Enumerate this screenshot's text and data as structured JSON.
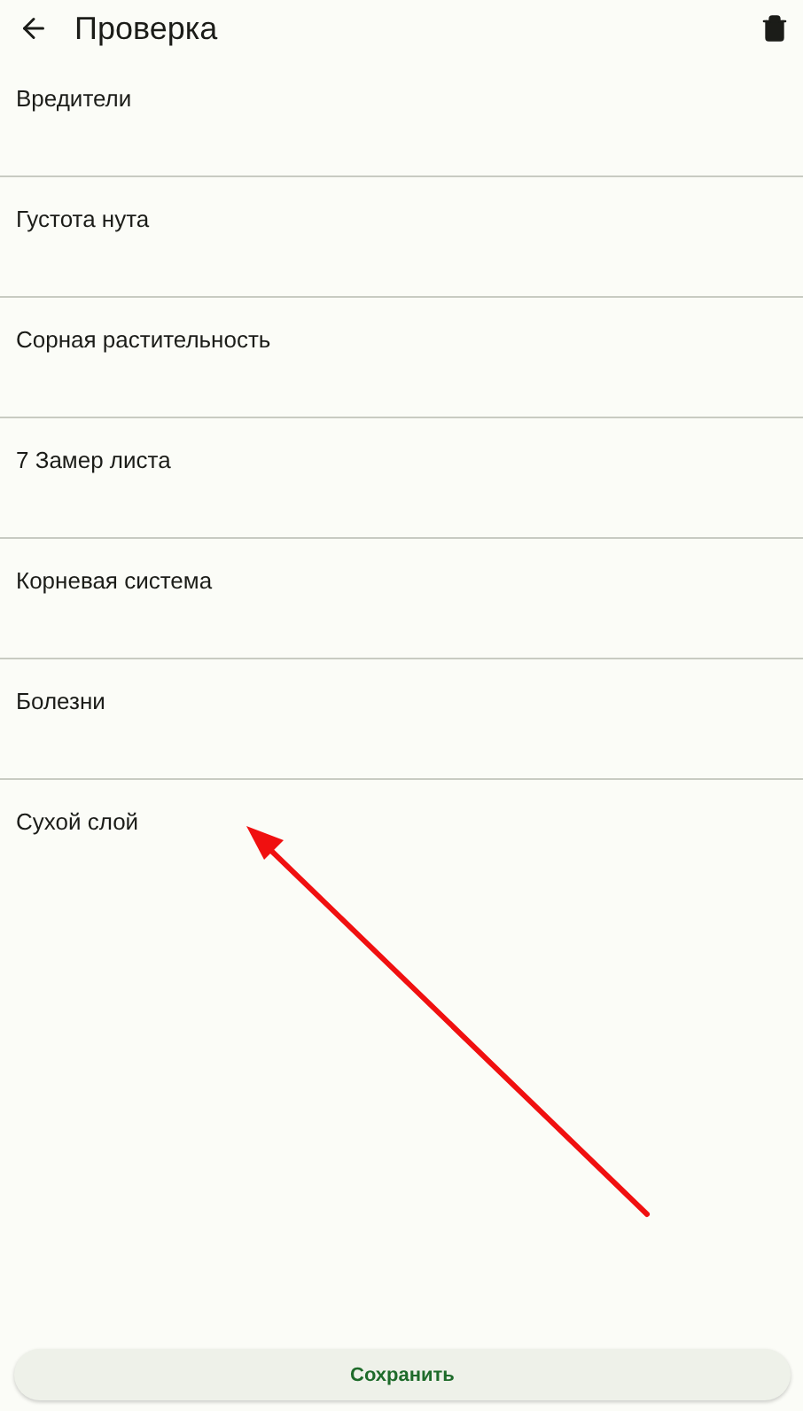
{
  "header": {
    "title": "Проверка"
  },
  "items": [
    {
      "label": "Вредители"
    },
    {
      "label": "Густота нута"
    },
    {
      "label": "Сорная растительность"
    },
    {
      "label": "7 Замер листа"
    },
    {
      "label": "Корневая система"
    },
    {
      "label": "Болезни"
    },
    {
      "label": "Сухой слой"
    }
  ],
  "save_button": {
    "label": "Сохранить"
  }
}
